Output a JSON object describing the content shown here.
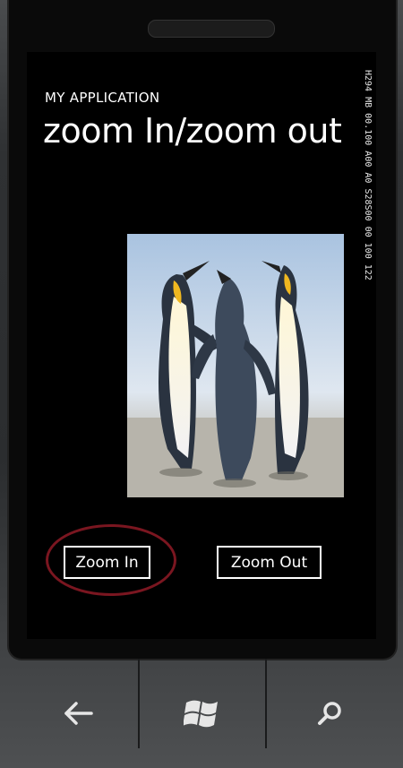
{
  "app": {
    "app_title": "MY APPLICATION",
    "page_title": "zoom In/zoom out"
  },
  "debug_counter": {
    "text": "H294 MB 00.100 A00 A0 S28S00 00 100 122"
  },
  "image": {
    "subject": "penguins-photo"
  },
  "buttons": {
    "zoom_in_label": "Zoom In",
    "zoom_out_label": "Zoom Out"
  },
  "hardware_keys": {
    "back": "back-arrow-icon",
    "start": "windows-logo-icon",
    "search": "search-icon"
  },
  "colors": {
    "screen_background": "#000000",
    "text": "#ffffff",
    "highlight_ring": "#7a1620"
  }
}
